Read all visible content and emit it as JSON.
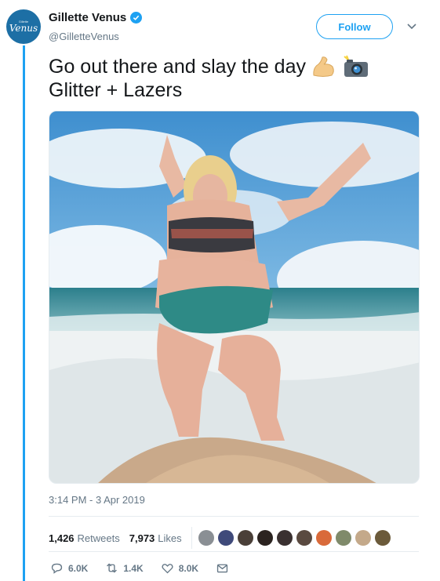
{
  "author": {
    "display_name": "Gillette Venus",
    "handle": "@GilletteVenus",
    "avatar_brand_small": "Gillette",
    "avatar_brand_main": "Venus",
    "verified": true,
    "verified_icon": "verified-badge-icon"
  },
  "follow_button": {
    "label": "Follow"
  },
  "menu_icon": "chevron-down-icon",
  "tweet": {
    "line1": "Go out there and slay the day",
    "line1_emojis": [
      "flexed-biceps-icon",
      "camera-with-flash-icon"
    ],
    "line2": "Glitter + Lazers"
  },
  "timestamp": "3:14 PM - 3 Apr 2019",
  "stats": {
    "retweets_count": "1,426",
    "retweets_label": "Retweets",
    "likes_count": "7,973",
    "likes_label": "Likes",
    "liker_avatar_count": 10
  },
  "actions": {
    "reply_count": "6.0K",
    "retweet_count": "1.4K",
    "like_count": "8.0K"
  },
  "colors": {
    "accent": "#1da1f2",
    "secondary_text": "#657786",
    "border": "#e6ecf0",
    "avatar_bg": "#1d6fa5"
  }
}
